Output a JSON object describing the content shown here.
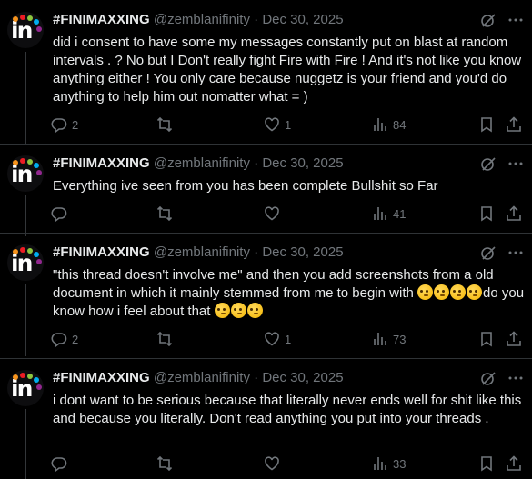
{
  "author": {
    "display_name": "#FINIMAXXING",
    "handle": "@zemblanifinity",
    "avatar_text": "in"
  },
  "colors": {
    "background": "#000000",
    "text": "#e7e9ea",
    "muted": "#71767b",
    "divider": "#2f3336"
  },
  "tweets": [
    {
      "date": "Dec 30, 2025",
      "text": "did i consent to have some my messages constantly put on blast at random intervals . ? No but I Don't really fight Fire with Fire !  And it's not like you know anything either ! You only care because nuggetz is your friend and you'd do anything to help him out nomatter what = )",
      "replies": "2",
      "reposts": "",
      "likes": "1",
      "views": "84"
    },
    {
      "date": "Dec 30, 2025",
      "text": "Everything ive seen from you has been complete Bullshit  so Far",
      "replies": "",
      "reposts": "",
      "likes": "",
      "views": "41"
    },
    {
      "date": "Dec 30, 2025",
      "text_a": "\"this thread doesn't involve me\" and then you add screenshots from a old document in which it mainly stemmed from me to begin with ",
      "text_b": "do you know how i feel about that ",
      "replies": "2",
      "reposts": "",
      "likes": "1",
      "views": "73"
    },
    {
      "date": "Dec 30, 2025",
      "text": "i dont want to be serious because that literally never ends well for shit like this and because you literally. Don't read anything you put into your threads .",
      "replies": "",
      "reposts": "",
      "likes": "",
      "views": "33"
    }
  ],
  "separator": " · ",
  "icons": {
    "reply": "reply-icon",
    "repost": "repost-icon",
    "like": "heart-icon",
    "views": "views-icon",
    "bookmark": "bookmark-icon",
    "share": "share-icon",
    "grok": "grok-icon",
    "more": "more-icon"
  }
}
